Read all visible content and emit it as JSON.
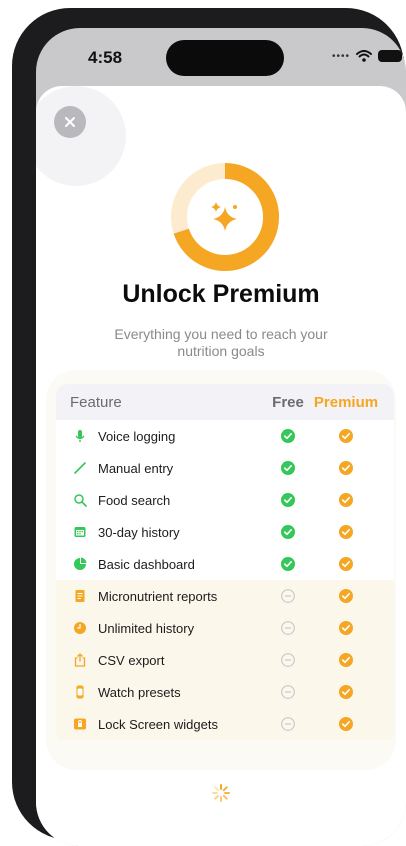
{
  "status_bar": {
    "time": "4:58",
    "signal_icon": "signal-dots-icon",
    "wifi_icon": "wifi-icon",
    "battery_icon": "battery-icon"
  },
  "paywall": {
    "close_icon": "close-icon",
    "hero_icon": "sparkles-icon",
    "title": "Unlock Premium",
    "subtitle": "Everything you need to reach your nutrition goals",
    "accent_color": "#f5a623",
    "free_check_color": "#34c759",
    "loading_icon": "spinner-icon"
  },
  "comparison": {
    "headers": {
      "feature": "Feature",
      "free": "Free",
      "premium": "Premium"
    },
    "rows": [
      {
        "icon": "microphone-icon",
        "label": "Voice logging",
        "free": "included",
        "premium": "included"
      },
      {
        "icon": "pencil-icon",
        "label": "Manual entry",
        "free": "included",
        "premium": "included"
      },
      {
        "icon": "magnifier-icon",
        "label": "Food search",
        "free": "included",
        "premium": "included"
      },
      {
        "icon": "calendar-icon",
        "label": "30-day history",
        "free": "included",
        "premium": "included"
      },
      {
        "icon": "pie-chart-icon",
        "label": "Basic dashboard",
        "free": "included",
        "premium": "included"
      },
      {
        "icon": "document-icon",
        "label": "Micronutrient reports",
        "free": "not-included",
        "premium": "included"
      },
      {
        "icon": "clock-icon",
        "label": "Unlimited history",
        "free": "not-included",
        "premium": "included"
      },
      {
        "icon": "share-icon",
        "label": "CSV export",
        "free": "not-included",
        "premium": "included"
      },
      {
        "icon": "watch-icon",
        "label": "Watch presets",
        "free": "not-included",
        "premium": "included"
      },
      {
        "icon": "lock-icon",
        "label": "Lock Screen widgets",
        "free": "not-included",
        "premium": "included"
      }
    ]
  }
}
